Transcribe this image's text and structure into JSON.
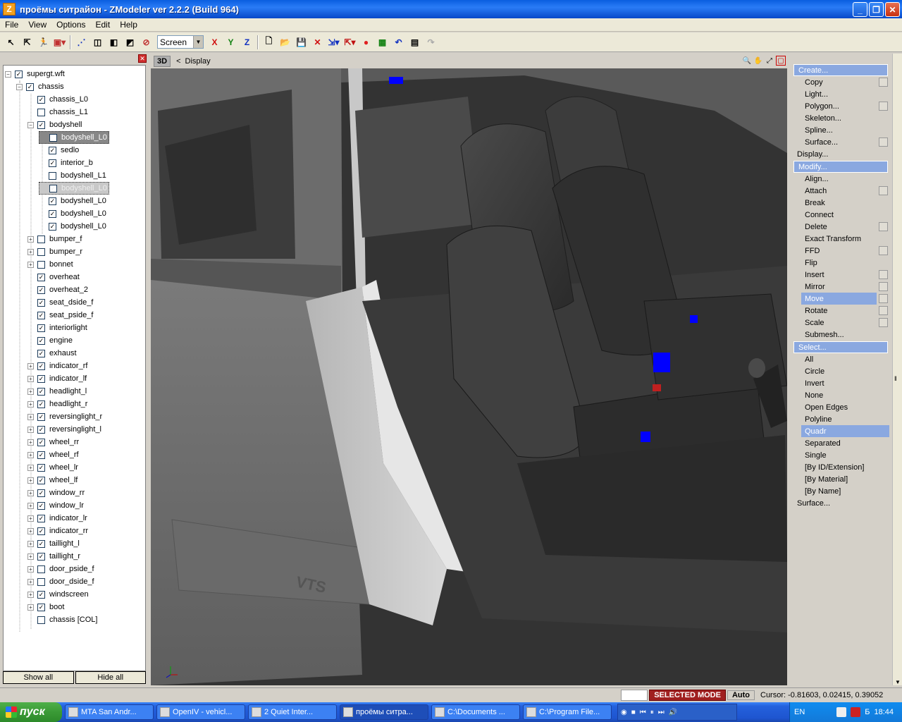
{
  "window": {
    "title": "проёмы ситрайон - ZModeler ver 2.2.2 (Build 964)",
    "app_icon": "Z"
  },
  "menu": [
    "File",
    "View",
    "Options",
    "Edit",
    "Help"
  ],
  "toolbar": {
    "space_select": "Screen",
    "axes": [
      "X",
      "Y",
      "Z"
    ],
    "icons": [
      "select-icon",
      "pick-icon",
      "walk-icon",
      "selection-mode-icon",
      "vertices-icon",
      "polygons-icon",
      "objects-icon",
      "faces-icon",
      "hidden-icon",
      "new-icon",
      "open-icon",
      "save-icon",
      "delete-icon",
      "import-icon",
      "export-icon",
      "record-icon",
      "tool-icon",
      "undo-icon",
      "notes-icon",
      "redo-icon"
    ]
  },
  "tree": {
    "nodes": [
      {
        "label": "supergt.wft",
        "depth": 0,
        "exp": "-",
        "checked": true
      },
      {
        "label": "chassis",
        "depth": 1,
        "exp": "-",
        "checked": true
      },
      {
        "label": "chassis_L0",
        "depth": 2,
        "exp": "",
        "checked": true
      },
      {
        "label": "chassis_L1",
        "depth": 2,
        "exp": "",
        "checked": false
      },
      {
        "label": "bodyshell",
        "depth": 2,
        "exp": "-",
        "checked": true
      },
      {
        "label": "bodyshell_L0",
        "depth": 3,
        "exp": "",
        "checked": true,
        "sel": 1
      },
      {
        "label": "sedlo",
        "depth": 3,
        "exp": "",
        "checked": true
      },
      {
        "label": "interior_b",
        "depth": 3,
        "exp": "",
        "checked": true
      },
      {
        "label": "bodyshell_L1",
        "depth": 3,
        "exp": "",
        "checked": false
      },
      {
        "label": "bodyshell_L0",
        "depth": 3,
        "exp": "",
        "checked": true,
        "sel": 2
      },
      {
        "label": "bodyshell_L0",
        "depth": 3,
        "exp": "",
        "checked": true
      },
      {
        "label": "bodyshell_L0",
        "depth": 3,
        "exp": "",
        "checked": true
      },
      {
        "label": "bodyshell_L0",
        "depth": 3,
        "exp": "",
        "checked": true
      },
      {
        "label": "bumper_f",
        "depth": 2,
        "exp": "+",
        "checked": false
      },
      {
        "label": "bumper_r",
        "depth": 2,
        "exp": "+",
        "checked": false
      },
      {
        "label": "bonnet",
        "depth": 2,
        "exp": "+",
        "checked": false
      },
      {
        "label": "overheat",
        "depth": 2,
        "exp": "",
        "checked": true
      },
      {
        "label": "overheat_2",
        "depth": 2,
        "exp": "",
        "checked": true
      },
      {
        "label": "seat_dside_f",
        "depth": 2,
        "exp": "",
        "checked": true
      },
      {
        "label": "seat_pside_f",
        "depth": 2,
        "exp": "",
        "checked": true
      },
      {
        "label": "interiorlight",
        "depth": 2,
        "exp": "",
        "checked": true
      },
      {
        "label": "engine",
        "depth": 2,
        "exp": "",
        "checked": true
      },
      {
        "label": "exhaust",
        "depth": 2,
        "exp": "",
        "checked": true
      },
      {
        "label": "indicator_rf",
        "depth": 2,
        "exp": "+",
        "checked": true
      },
      {
        "label": "indicator_lf",
        "depth": 2,
        "exp": "+",
        "checked": true
      },
      {
        "label": "headlight_l",
        "depth": 2,
        "exp": "+",
        "checked": true
      },
      {
        "label": "headlight_r",
        "depth": 2,
        "exp": "+",
        "checked": true
      },
      {
        "label": "reversinglight_r",
        "depth": 2,
        "exp": "+",
        "checked": true
      },
      {
        "label": "reversinglight_l",
        "depth": 2,
        "exp": "+",
        "checked": true
      },
      {
        "label": "wheel_rr",
        "depth": 2,
        "exp": "+",
        "checked": true
      },
      {
        "label": "wheel_rf",
        "depth": 2,
        "exp": "+",
        "checked": true
      },
      {
        "label": "wheel_lr",
        "depth": 2,
        "exp": "+",
        "checked": true
      },
      {
        "label": "wheel_lf",
        "depth": 2,
        "exp": "+",
        "checked": true
      },
      {
        "label": "window_rr",
        "depth": 2,
        "exp": "+",
        "checked": true
      },
      {
        "label": "window_lr",
        "depth": 2,
        "exp": "+",
        "checked": true
      },
      {
        "label": "indicator_lr",
        "depth": 2,
        "exp": "+",
        "checked": true
      },
      {
        "label": "indicator_rr",
        "depth": 2,
        "exp": "+",
        "checked": true
      },
      {
        "label": "taillight_l",
        "depth": 2,
        "exp": "+",
        "checked": true
      },
      {
        "label": "taillight_r",
        "depth": 2,
        "exp": "+",
        "checked": true
      },
      {
        "label": "door_pside_f",
        "depth": 2,
        "exp": "+",
        "checked": false
      },
      {
        "label": "door_dside_f",
        "depth": 2,
        "exp": "+",
        "checked": false
      },
      {
        "label": "windscreen",
        "depth": 2,
        "exp": "+",
        "checked": true
      },
      {
        "label": "boot",
        "depth": 2,
        "exp": "+",
        "checked": true
      },
      {
        "label": "chassis [COL]",
        "depth": 2,
        "exp": "",
        "checked": false
      }
    ],
    "show_all": "Show all",
    "hide_all": "Hide all"
  },
  "viewport": {
    "mode": "3D",
    "breadcrumb_sep": "<",
    "breadcrumb": "Display",
    "door_text": "VTS"
  },
  "right_panel": {
    "items": [
      {
        "label": "Create...",
        "type": "hdr"
      },
      {
        "label": "Copy",
        "type": "sub",
        "box": true
      },
      {
        "label": "Light...",
        "type": "sub"
      },
      {
        "label": "Polygon...",
        "type": "sub",
        "box": true
      },
      {
        "label": "Skeleton...",
        "type": "sub"
      },
      {
        "label": "Spline...",
        "type": "sub"
      },
      {
        "label": "Surface...",
        "type": "sub",
        "box": true
      },
      {
        "label": "Display...",
        "type": "top"
      },
      {
        "label": "Modify...",
        "type": "hdr"
      },
      {
        "label": "Align...",
        "type": "sub"
      },
      {
        "label": "Attach",
        "type": "sub",
        "box": true
      },
      {
        "label": "Break",
        "type": "sub"
      },
      {
        "label": "Connect",
        "type": "sub"
      },
      {
        "label": "Delete",
        "type": "sub",
        "box": true
      },
      {
        "label": "Exact Transform",
        "type": "sub"
      },
      {
        "label": "FFD",
        "type": "sub",
        "box": true
      },
      {
        "label": "Flip",
        "type": "sub"
      },
      {
        "label": "Insert",
        "type": "sub",
        "box": true
      },
      {
        "label": "Mirror",
        "type": "sub",
        "box": true
      },
      {
        "label": "Move",
        "type": "hl",
        "box": true
      },
      {
        "label": "Rotate",
        "type": "sub",
        "box": true
      },
      {
        "label": "Scale",
        "type": "sub",
        "box": true
      },
      {
        "label": "Submesh...",
        "type": "sub"
      },
      {
        "label": "Select...",
        "type": "hdr"
      },
      {
        "label": "All",
        "type": "sub"
      },
      {
        "label": "Circle",
        "type": "sub"
      },
      {
        "label": "Invert",
        "type": "sub"
      },
      {
        "label": "None",
        "type": "sub"
      },
      {
        "label": "Open Edges",
        "type": "sub"
      },
      {
        "label": "Polyline",
        "type": "sub"
      },
      {
        "label": "Quadr",
        "type": "hl2"
      },
      {
        "label": "Separated",
        "type": "sub"
      },
      {
        "label": "Single",
        "type": "sub"
      },
      {
        "label": "[By ID/Extension]",
        "type": "sub"
      },
      {
        "label": "[By Material]",
        "type": "sub"
      },
      {
        "label": "[By Name]",
        "type": "sub"
      },
      {
        "label": "Surface...",
        "type": "top"
      }
    ]
  },
  "status": {
    "mode": "SELECTED MODE",
    "auto": "Auto",
    "cursor": "Cursor: -0.81603, 0.02415, 0.39052"
  },
  "taskbar": {
    "start": "пуск",
    "tasks": [
      "MTA San Andr...",
      "OpenIV - vehicl...",
      "2 Quiet Inter...",
      "проёмы ситра...",
      "C:\\Documents ...",
      "C:\\Program File..."
    ],
    "active_task": 3,
    "lang": "EN",
    "tray_text": "Б",
    "time": "18:44"
  }
}
